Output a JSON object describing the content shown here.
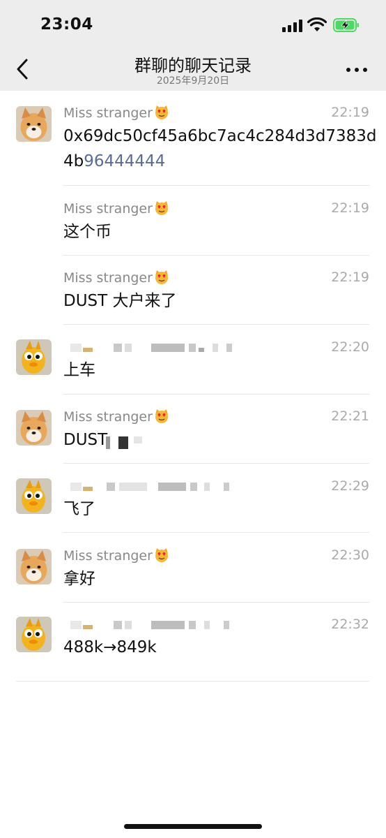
{
  "status_bar": {
    "time": "23:04"
  },
  "nav": {
    "title": "群聊的聊天记录",
    "subtitle": "2025年9月20日"
  },
  "messages": [
    {
      "sender": "Miss stranger",
      "time": "22:19",
      "text_plain": "0x69dc50cf45a6bc7ac4c284d3d7383d4b",
      "text_link": "96444444"
    },
    {
      "sender": "Miss stranger",
      "time": "22:19",
      "text": "这个币"
    },
    {
      "sender": "Miss stranger",
      "time": "22:19",
      "text": "DUST 大户来了"
    },
    {
      "sender": "",
      "time": "22:20",
      "text": "上车"
    },
    {
      "sender": "Miss stranger",
      "time": "22:21",
      "text": "DUST"
    },
    {
      "sender": "",
      "time": "22:29",
      "text": "飞了"
    },
    {
      "sender": "Miss stranger",
      "time": "22:30",
      "text": "拿好"
    },
    {
      "sender": "",
      "time": "22:32",
      "text": "488k→849k"
    }
  ],
  "icons": {
    "back": "chevron-left-icon",
    "more": "more-dots-icon",
    "sender_emoji": "heart-eyes-cat-emoji",
    "signal": "cellular-signal-icon",
    "wifi": "wifi-icon",
    "battery": "battery-charging-icon"
  },
  "colors": {
    "nav_background": "#ededed",
    "link": "#586c97",
    "battery_fill": "#4cd964",
    "sender_name": "#888888"
  }
}
